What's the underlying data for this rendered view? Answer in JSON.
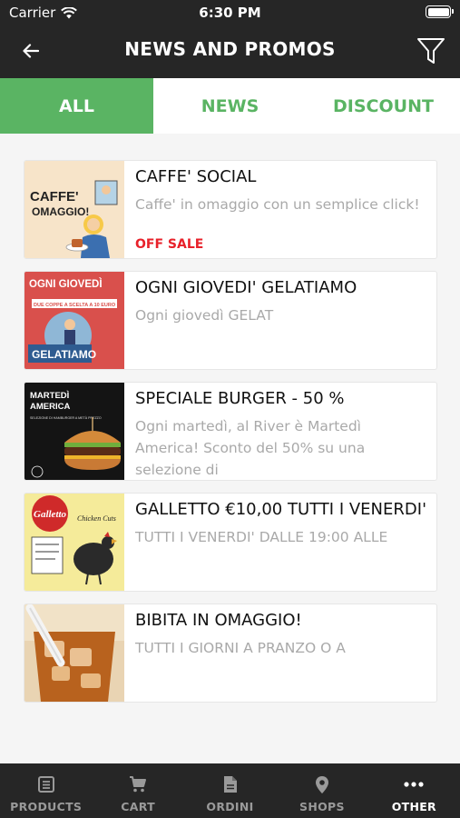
{
  "status_bar": {
    "carrier": "Carrier",
    "time": "6:30 PM"
  },
  "header": {
    "title": "NEWS AND PROMOS"
  },
  "tabs": [
    {
      "label": "ALL",
      "active": true
    },
    {
      "label": "NEWS",
      "active": false
    },
    {
      "label": "DISCOUNT",
      "active": false
    }
  ],
  "items": [
    {
      "title": "CAFFE' SOCIAL",
      "description": "Caffe' in omaggio con un semplice click!",
      "tag": "OFF SALE",
      "image": {
        "line1": "CAFFE'",
        "line2": "OMAGGIO!"
      }
    },
    {
      "title": "OGNI GIOVEDI' GELATIAMO",
      "description": "Ogni giovedì GELAT",
      "image": {
        "line1": "OGNI GIOVEDÌ",
        "line2": "GELATIAMO",
        "small": "DUE COPPE A SCELTA A 10 EURO"
      }
    },
    {
      "title": "SPECIALE BURGER - 50 %",
      "description": "Ogni martedì, al River è Martedì America! Sconto del 50% su una selezione di",
      "image": {
        "line1": "MARTEDÌ",
        "line2": "AMERICA",
        "small": "SELEZIONE DI HAMBURGER A METÀ PREZZO"
      }
    },
    {
      "title": "GALLETTO €10,00 TUTTI I VENERDI'",
      "description": "TUTTI I VENERDI' DALLE 19:00 ALLE",
      "image": {
        "line1": "Galletto",
        "line2": "Chicken Cuts"
      }
    },
    {
      "title": "BIBITA IN OMAGGIO!",
      "description": "TUTTI I GIORNI A PRANZO O A",
      "image": {}
    }
  ],
  "tabbar": [
    {
      "label": "PRODUCTS",
      "icon": "list-icon",
      "active": false
    },
    {
      "label": "CART",
      "icon": "cart-icon",
      "active": false
    },
    {
      "label": "ORDINI",
      "icon": "document-icon",
      "active": false
    },
    {
      "label": "SHOPS",
      "icon": "location-pin-icon",
      "active": false
    },
    {
      "label": "OTHER",
      "icon": "more-dots-icon",
      "active": true
    }
  ],
  "colors": {
    "accent": "#5ab463",
    "dark": "#262626",
    "sale": "#e8212a"
  }
}
